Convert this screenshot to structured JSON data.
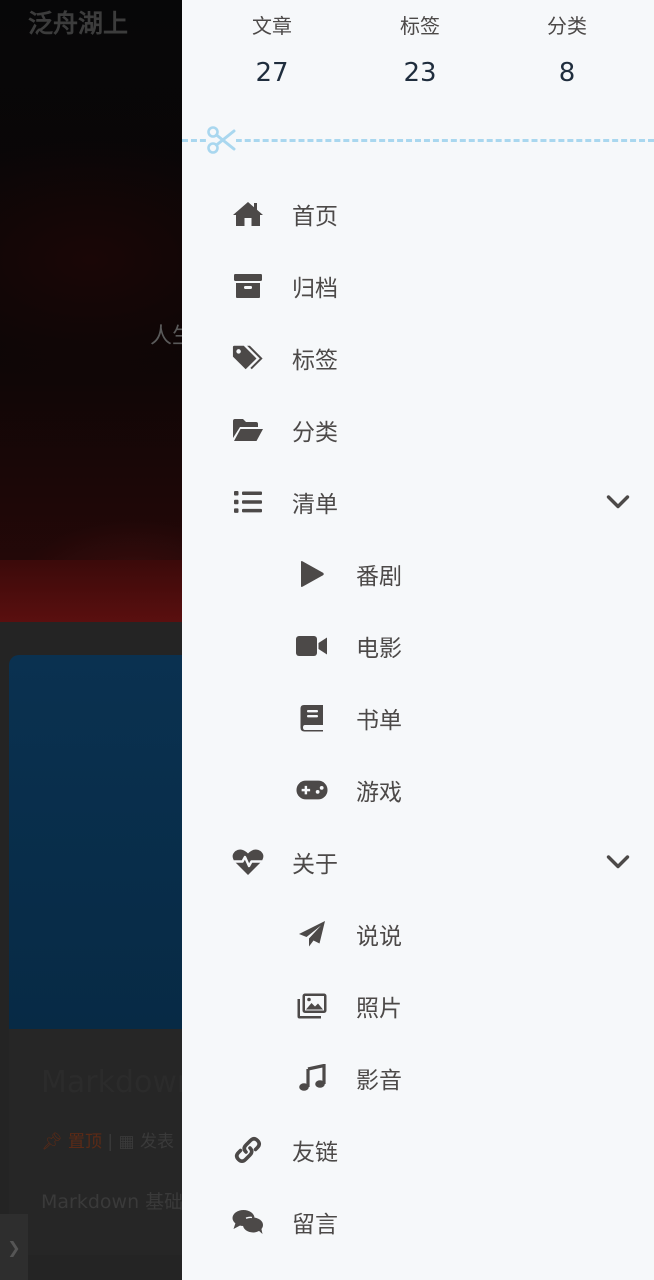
{
  "background": {
    "blog_title": "泛舟湖上",
    "hero_subtitle": "人生",
    "post": {
      "title": "Markdown",
      "pinned_label": "置顶",
      "date_prefix": "发表",
      "excerpt": "Markdown 基础 本格式的标记语"
    }
  },
  "stats": [
    {
      "label": "文章",
      "value": "27"
    },
    {
      "label": "标签",
      "value": "23"
    },
    {
      "label": "分类",
      "value": "8"
    }
  ],
  "menu": {
    "home": {
      "label": "首页",
      "icon": "home-icon"
    },
    "archive": {
      "label": "归档",
      "icon": "archive-icon"
    },
    "tags": {
      "label": "标签",
      "icon": "tags-icon"
    },
    "categories": {
      "label": "分类",
      "icon": "folder-open-icon"
    },
    "list": {
      "label": "清单",
      "icon": "list-icon",
      "expanded": true,
      "children": [
        {
          "label": "番剧",
          "icon": "play-icon"
        },
        {
          "label": "电影",
          "icon": "video-icon"
        },
        {
          "label": "书单",
          "icon": "book-icon"
        },
        {
          "label": "游戏",
          "icon": "gamepad-icon"
        }
      ]
    },
    "about": {
      "label": "关于",
      "icon": "heartbeat-icon",
      "expanded": true,
      "children": [
        {
          "label": "说说",
          "icon": "paper-plane-icon"
        },
        {
          "label": "照片",
          "icon": "images-icon"
        },
        {
          "label": "影音",
          "icon": "music-icon"
        }
      ]
    },
    "links": {
      "label": "友链",
      "icon": "link-icon"
    },
    "message": {
      "label": "留言",
      "icon": "comments-icon"
    }
  },
  "colors": {
    "drawer_bg": "#f6f8fa",
    "text": "#4c4948",
    "icon": "#4c4948",
    "divider": "#a9d7ef",
    "overlay": "#000000"
  }
}
